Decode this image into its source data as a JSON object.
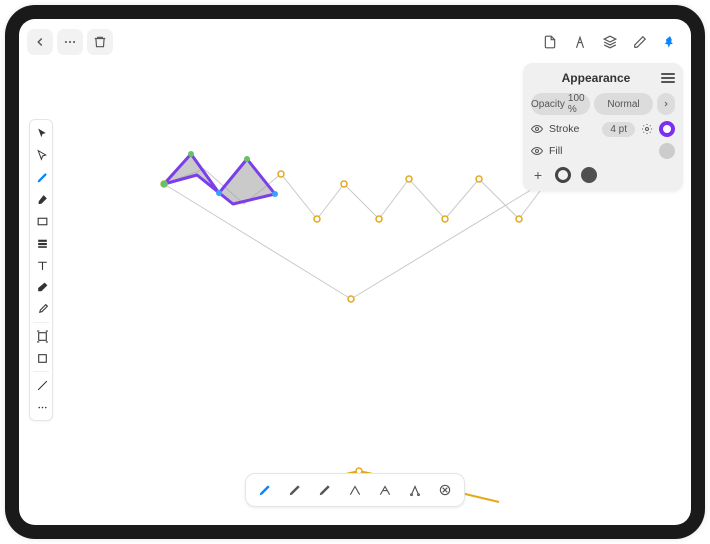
{
  "panel": {
    "title": "Appearance",
    "opacity_label": "Opacity",
    "opacity_value": "100 %",
    "blend_mode": "Normal",
    "stroke_label": "Stroke",
    "stroke_value": "4 pt",
    "fill_label": "Fill"
  },
  "colors": {
    "stroke_swatch": "#7b2ff2",
    "fill_swatch": "#cccccc",
    "accent": "#0a84ff",
    "anchor": "#e6a817",
    "path_gray": "#c9c9c9",
    "shape_fill": "#9f9f9f",
    "shape_stroke": "#7a3eea"
  },
  "icons": {
    "back": "chevron-left",
    "more": "ellipsis",
    "trash": "trash",
    "doc": "document",
    "precision": "compass",
    "layers": "layers",
    "edit": "pencil",
    "pointer": "pin",
    "gear": "gear",
    "menu": "menu",
    "plus": "+",
    "close": "close-circle"
  }
}
